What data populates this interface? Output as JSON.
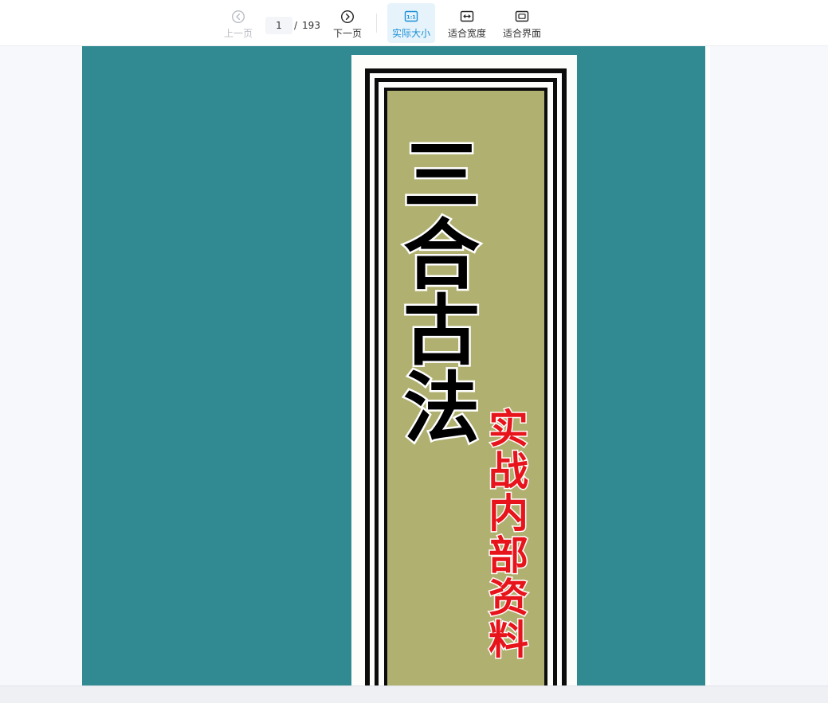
{
  "toolbar": {
    "prev_label": "上一页",
    "next_label": "下一页",
    "current_page": "1",
    "page_sep": "/",
    "total_pages": "193",
    "actual_size_label": "实际大小",
    "fit_width_label": "适合宽度",
    "fit_screen_label": "适合界面",
    "actual_size_icon_text": "1:1",
    "icons": {
      "prev": "chevron-left-circle-icon",
      "next": "chevron-right-circle-icon",
      "actual": "actual-size-icon",
      "width": "fit-width-icon",
      "screen": "fit-screen-icon"
    }
  },
  "cover": {
    "title_chars": [
      "三",
      "合",
      "古",
      "法"
    ],
    "subtitle_chars": [
      "实",
      "战",
      "内",
      "部",
      "资",
      "料"
    ]
  },
  "colors": {
    "accent": "#1a8fd6",
    "page_bg": "#318a91",
    "panel": "#b0b070",
    "subtitle": "#e8141c"
  }
}
